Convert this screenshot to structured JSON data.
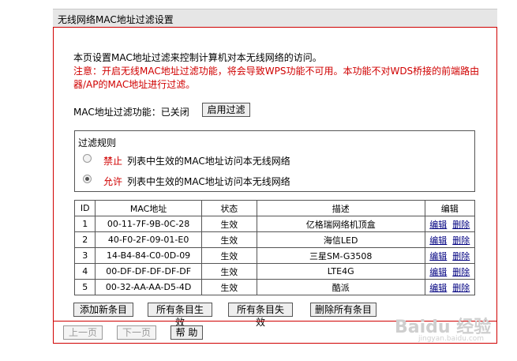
{
  "title": "无线网络MAC地址过滤设置",
  "intro": "本页设置MAC地址过滤来控制计算机对本无线网络的访问。",
  "notice_line1": "注意：开启无线MAC地址过滤功能，将会导致WPS功能不可用。本功能不对WDS桥接的前端路由",
  "notice_line2": "器/AP的MAC地址进行过滤。",
  "filter_status_label": "MAC地址过滤功能：已关闭",
  "enable_button": "启用过滤",
  "rules": {
    "legend": "过滤规则",
    "deny_keyword": "禁止",
    "deny_text": "列表中生效的MAC地址访问本无线网络",
    "allow_keyword": "允许",
    "allow_text": "列表中生效的MAC地址访问本无线网络",
    "selected": "allow"
  },
  "table": {
    "headers": [
      "ID",
      "MAC地址",
      "状态",
      "描述",
      "编辑"
    ],
    "edit_label": "编辑",
    "delete_label": "删除",
    "rows": [
      {
        "id": "1",
        "mac": "00-11-7F-9B-0C-28",
        "status": "生效",
        "desc": "亿格瑞网络机顶盒"
      },
      {
        "id": "2",
        "mac": "40-F0-2F-09-01-E0",
        "status": "生效",
        "desc": "海信LED"
      },
      {
        "id": "3",
        "mac": "14-B4-84-C0-0D-09",
        "status": "生效",
        "desc": "三星SM-G3508"
      },
      {
        "id": "4",
        "mac": "00-DF-DF-DF-DF-DF",
        "status": "生效",
        "desc": "LTE4G"
      },
      {
        "id": "5",
        "mac": "00-32-AA-AA-D5-4D",
        "status": "生效",
        "desc": "酷派"
      }
    ]
  },
  "actions": {
    "add": "添加新条目",
    "enable_all": "所有条目生效",
    "disable_all": "所有条目失效",
    "delete_all": "删除所有条目"
  },
  "nav": {
    "prev": "上一页",
    "next": "下一页",
    "help": "帮 助"
  },
  "watermark": "Baidu 经验",
  "watermark_sub": "jingyan.baidu.com"
}
